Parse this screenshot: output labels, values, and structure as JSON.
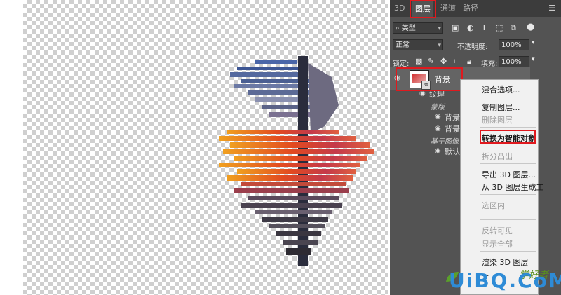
{
  "tabs": [
    {
      "label": "3D",
      "active": false
    },
    {
      "label": "图层",
      "active": true
    },
    {
      "label": "通道",
      "active": false
    },
    {
      "label": "路径",
      "active": false
    }
  ],
  "filter": {
    "value": "类型"
  },
  "blend": {
    "mode": "正常",
    "opacity_label": "不透明度:",
    "opacity": "100%"
  },
  "lock": {
    "label": "锁定:",
    "fill_label": "填充:",
    "fill": "100%"
  },
  "layers": {
    "background": "背景",
    "texture": "纹理",
    "mask": "蒙版",
    "bg1": "背景",
    "bg2": "背景",
    "smart_sub": "基于图像",
    "default": "默认"
  },
  "context_menu": {
    "blend_options": "混合选项...",
    "duplicate": "复制图层...",
    "delete": "删除图层",
    "convert_smart": "转换为智能对象",
    "split_extrude": "拆分凸出",
    "export_3d": "导出 3D 图层...",
    "from_3d": "从 3D 图层生成工",
    "select_area": "选区内",
    "invert_visible": "反转可见",
    "show_all": "显示全部",
    "render_3d": "渲染 3D 图层",
    "last_item": "..."
  },
  "watermark": {
    "logo": "UiBQ.CoM",
    "sub": "学好者"
  },
  "colors": {
    "accent": "#e0191e",
    "panel": "#535353",
    "menu": "#f1f1f1",
    "watermark": "#2e8bd6"
  }
}
